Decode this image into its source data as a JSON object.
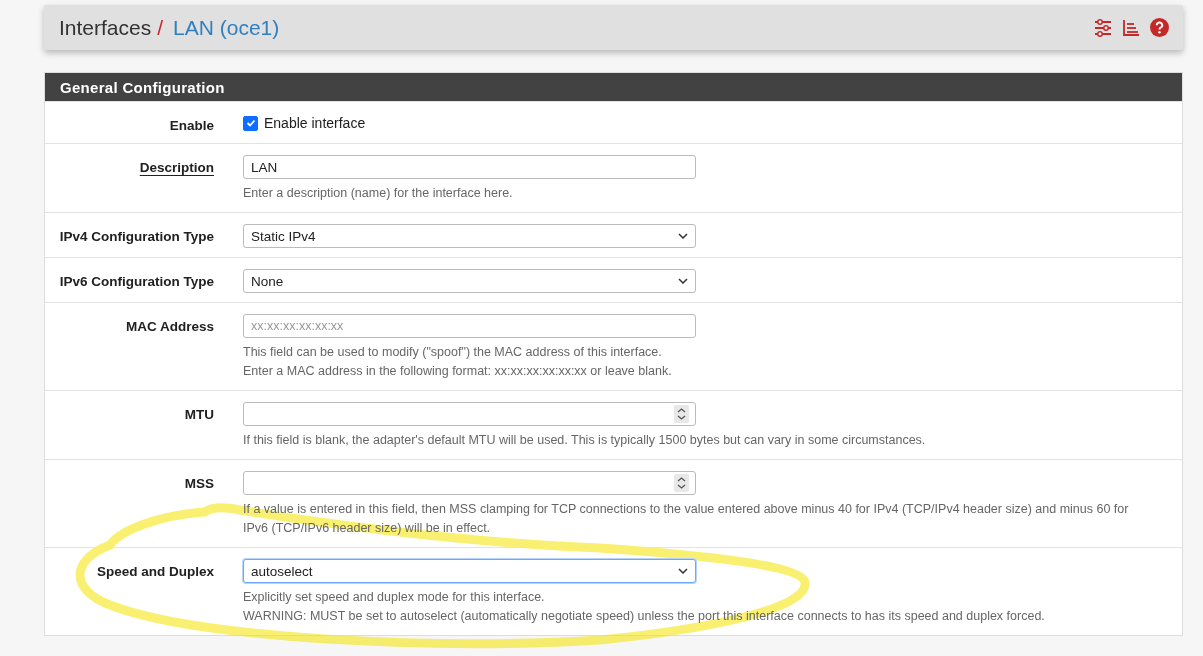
{
  "breadcrumb": {
    "section": "Interfaces",
    "separator": "/",
    "current": "LAN (oce1)"
  },
  "panel": {
    "title": "General Configuration",
    "rows": [
      {
        "label": "Enable",
        "required": false,
        "kind": "checkbox",
        "checkbox_label": "Enable interface",
        "checked": true,
        "help": []
      },
      {
        "label": "Description",
        "required": true,
        "kind": "text",
        "value": "LAN",
        "help": [
          "Enter a description (name) for the interface here."
        ]
      },
      {
        "label": "IPv4 Configuration Type",
        "required": false,
        "kind": "select",
        "value": "Static IPv4",
        "focused": false,
        "help": []
      },
      {
        "label": "IPv6 Configuration Type",
        "required": false,
        "kind": "select",
        "value": "None",
        "focused": false,
        "help": []
      },
      {
        "label": "MAC Address",
        "required": false,
        "kind": "text",
        "placeholder": "xx:xx:xx:xx:xx:xx",
        "help": [
          "This field can be used to modify (\"spoof\") the MAC address of this interface.",
          "Enter a MAC address in the following format: xx:xx:xx:xx:xx:xx or leave blank."
        ]
      },
      {
        "label": "MTU",
        "required": false,
        "kind": "number",
        "help": [
          "If this field is blank, the adapter's default MTU will be used. This is typically 1500 bytes but can vary in some circumstances."
        ]
      },
      {
        "label": "MSS",
        "required": false,
        "kind": "number",
        "help": [
          "If a value is entered in this field, then MSS clamping for TCP connections to the value entered above minus 40 for IPv4 (TCP/IPv4 header size) and minus 60 for IPv6 (TCP/IPv6 header size) will be in effect."
        ]
      },
      {
        "label": "Speed and Duplex",
        "required": false,
        "kind": "select",
        "value": "autoselect",
        "focused": true,
        "help": [
          "Explicitly set speed and duplex mode for this interface.",
          "WARNING: MUST be set to autoselect (automatically negotiate speed) unless the port this interface connects to has its speed and duplex forced."
        ]
      }
    ]
  }
}
